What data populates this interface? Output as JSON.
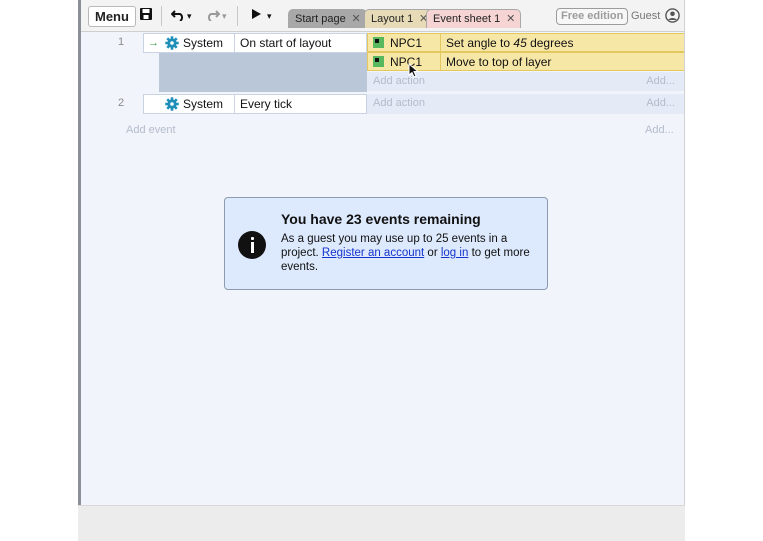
{
  "toolbar": {
    "menu_label": "Menu",
    "icons": [
      "save-icon",
      "undo-icon",
      "redo-icon",
      "play-icon"
    ],
    "dropdown_arrow": "▾",
    "tabs": [
      {
        "label": "Start page",
        "close": "✕"
      },
      {
        "label": "Layout 1",
        "close": "✕"
      },
      {
        "label": "Event sheet 1",
        "close": "✕"
      }
    ],
    "free_edition": "Free edition",
    "guest": "Guest"
  },
  "events": [
    {
      "number": "1",
      "condition": {
        "object": "System",
        "text": "On start of layout",
        "trigger_icon": "→"
      },
      "actions": [
        {
          "object": "NPC1",
          "text_prefix": "Set angle to ",
          "value": "45",
          "text_suffix": " degrees"
        },
        {
          "object": "NPC1",
          "text": "Move to top of layer"
        }
      ],
      "add_action": "Add action",
      "add_more": "Add..."
    },
    {
      "number": "2",
      "condition": {
        "object": "System",
        "text": "Every tick"
      },
      "add_action": "Add action",
      "add_more": "Add..."
    }
  ],
  "add_event": "Add event",
  "add_event_more": "Add...",
  "dialog": {
    "title": "You have 23 events remaining",
    "text_1": "As a guest you may use up to 25 events in a project.",
    "link_register": "Register an account",
    "text_or": "or",
    "link_login": "log in",
    "text_end": "to get more events."
  },
  "colors": {
    "action_bg": "#f7e7a7",
    "dialog_bg": "#dde9fc",
    "link": "#1534cc",
    "system_gear": "#1f8fb8"
  }
}
